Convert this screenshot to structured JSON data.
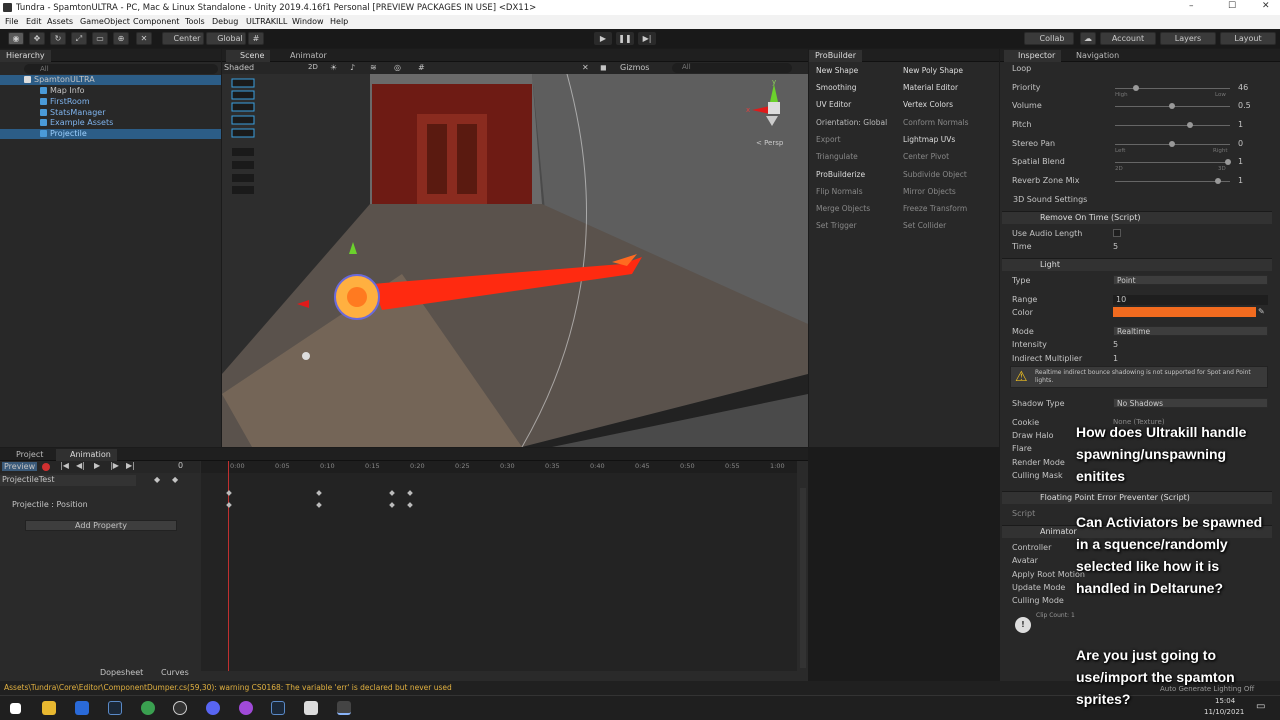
{
  "window": {
    "title": "Tundra - SpamtonULTRA - PC, Mac & Linux Standalone - Unity 2019.4.16f1 Personal [PREVIEW PACKAGES IN USE] <DX11>",
    "controls": [
      "–",
      "☐",
      "✕"
    ]
  },
  "menu": [
    "File",
    "Edit",
    "Assets",
    "GameObject",
    "Component",
    "Tools",
    "Debug",
    "ULTRAKILL",
    "Window",
    "Help"
  ],
  "toolbar": {
    "pivot": "Center",
    "space": "Global",
    "collab": "Collab",
    "account": "Account",
    "layers": "Layers",
    "layout": "Layout"
  },
  "hierarchy": {
    "tab": "Hierarchy",
    "search_placeholder": "All",
    "scene": "SpamtonULTRA",
    "items": [
      "Map Info",
      "FirstRoom",
      "StatsManager",
      "Example Assets",
      "Projectile"
    ]
  },
  "scene": {
    "tabs": [
      "Scene",
      "Animator"
    ],
    "shading": "Shaded",
    "mode2d": "2D",
    "gizmos": "Gizmos",
    "search_placeholder": "All",
    "persp": "< Persp",
    "axis": {
      "x": "x",
      "y": "y",
      "z": "z"
    }
  },
  "probuilder": {
    "tab": "ProBuilder",
    "left": [
      "New Shape",
      "Smoothing",
      "UV Editor",
      "Orientation: Global",
      "Export",
      "Triangulate",
      "ProBuilderize",
      "Flip Normals",
      "Merge Objects",
      "Set Trigger"
    ],
    "right": [
      "New Poly Shape",
      "Material Editor",
      "Vertex Colors",
      "Conform Normals",
      "Lightmap UVs",
      "Center Pivot",
      "Subdivide Object",
      "Mirror Objects",
      "Freeze Transform",
      "Set Collider"
    ]
  },
  "inspector": {
    "tabs": [
      "Inspector",
      "Navigation"
    ],
    "loop_label": "Loop",
    "priority": {
      "label": "Priority",
      "value": "46",
      "min": "High",
      "max": "Low"
    },
    "volume": {
      "label": "Volume",
      "value": "0.5"
    },
    "pitch": {
      "label": "Pitch",
      "value": "1"
    },
    "stereo_pan": {
      "label": "Stereo Pan",
      "value": "0",
      "min": "Left",
      "max": "Right"
    },
    "spatial_blend": {
      "label": "Spatial Blend",
      "value": "1",
      "min": "2D",
      "max": "3D"
    },
    "reverb": {
      "label": "Reverb Zone Mix",
      "value": "1"
    },
    "sound3d": "3D Sound Settings",
    "remove_on_time": "Remove On Time (Script)",
    "use_audio_length": "Use Audio Length",
    "time": {
      "label": "Time",
      "value": "5"
    },
    "light": "Light",
    "type": {
      "label": "Type",
      "value": "Point"
    },
    "range": {
      "label": "Range",
      "value": "10"
    },
    "color_label": "Color",
    "light_color": "#f26b1f",
    "mode": {
      "label": "Mode",
      "value": "Realtime"
    },
    "intensity": {
      "label": "Intensity",
      "value": "5"
    },
    "indirect": {
      "label": "Indirect Multiplier",
      "value": "1"
    },
    "warning": "Realtime indirect bounce shadowing is not supported for Spot and Point lights.",
    "shadow_type": {
      "label": "Shadow Type",
      "value": "No Shadows"
    },
    "cookie": {
      "label": "Cookie",
      "value": "None (Texture)"
    },
    "draw_halo": "Draw Halo",
    "flare": "Flare",
    "render_mode": "Render Mode",
    "culling_mask": "Culling Mask",
    "floating": "Floating Point Error Preventer (Script)",
    "script_label": "Script",
    "animator": "Animator",
    "controller": "Controller",
    "avatar": "Avatar",
    "apply_root": "Apply Root Motion",
    "update_mode": "Update Mode",
    "culling_mode": "Culling Mode",
    "clip_count": "Clip Count: 1"
  },
  "animation": {
    "tabs": [
      "Project",
      "Animation"
    ],
    "preview": "Preview",
    "frame": "0",
    "clip": "ProjectileTest",
    "property": "Projectile : Position",
    "add_property": "Add Property",
    "ticks": [
      "0:00",
      "0:05",
      "0:10",
      "0:15",
      "0:20",
      "0:25",
      "0:30",
      "0:35",
      "0:40",
      "0:45",
      "0:50",
      "0:55",
      "1:00"
    ],
    "dopesheet": "Dopesheet",
    "curves": "Curves"
  },
  "status": "Assets\\Tundra\\Core\\Editor\\ComponentDumper.cs(59,30): warning CS0168: The variable 'err' is declared but never used",
  "overlay": [
    "How does Ultrakill handle spawning/unspawning enitites",
    "Can Activiators be spawned in a squence/randomly selected like how it is handled in Deltarune?",
    "Are you just going to use/import the spamton sprites?"
  ],
  "taskbar": {
    "time": "15:04",
    "date": "11/10/2021",
    "lighting": "Auto Generate Lighting Off"
  }
}
